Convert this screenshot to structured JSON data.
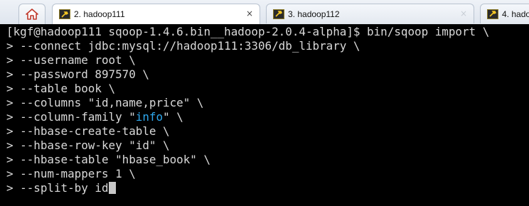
{
  "tabs": [
    {
      "label": "2. hadoop111",
      "active": true,
      "close": "×"
    },
    {
      "label": "3. hadoop112",
      "active": false,
      "close": "×"
    },
    {
      "label": "4. hado",
      "active": false
    }
  ],
  "icons": {
    "home": "home-icon",
    "session": "wrench-icon"
  },
  "colors": {
    "terminal_bg": "#000000",
    "terminal_fg": "#d9d9d9",
    "highlight": "#2ea8ee",
    "tabbar_bg": "#e4e9f0"
  },
  "terminal": {
    "lines": [
      "[kgf@hadoop111 sqoop-1.4.6.bin__hadoop-2.0.4-alpha]$ bin/sqoop import \\",
      "> --connect jdbc:mysql://hadoop111:3306/db_library \\",
      "> --username root \\",
      "> --password 897570 \\",
      "> --table book \\",
      "> --columns \"id,name,price\" \\",
      {
        "before": "> --column-family \"",
        "highlight": "info",
        "after": "\" \\"
      },
      "> --hbase-create-table \\",
      "> --hbase-row-key \"id\" \\",
      "> --hbase-table \"hbase_book\" \\",
      "> --num-mappers 1 \\",
      "> --split-by id"
    ]
  }
}
